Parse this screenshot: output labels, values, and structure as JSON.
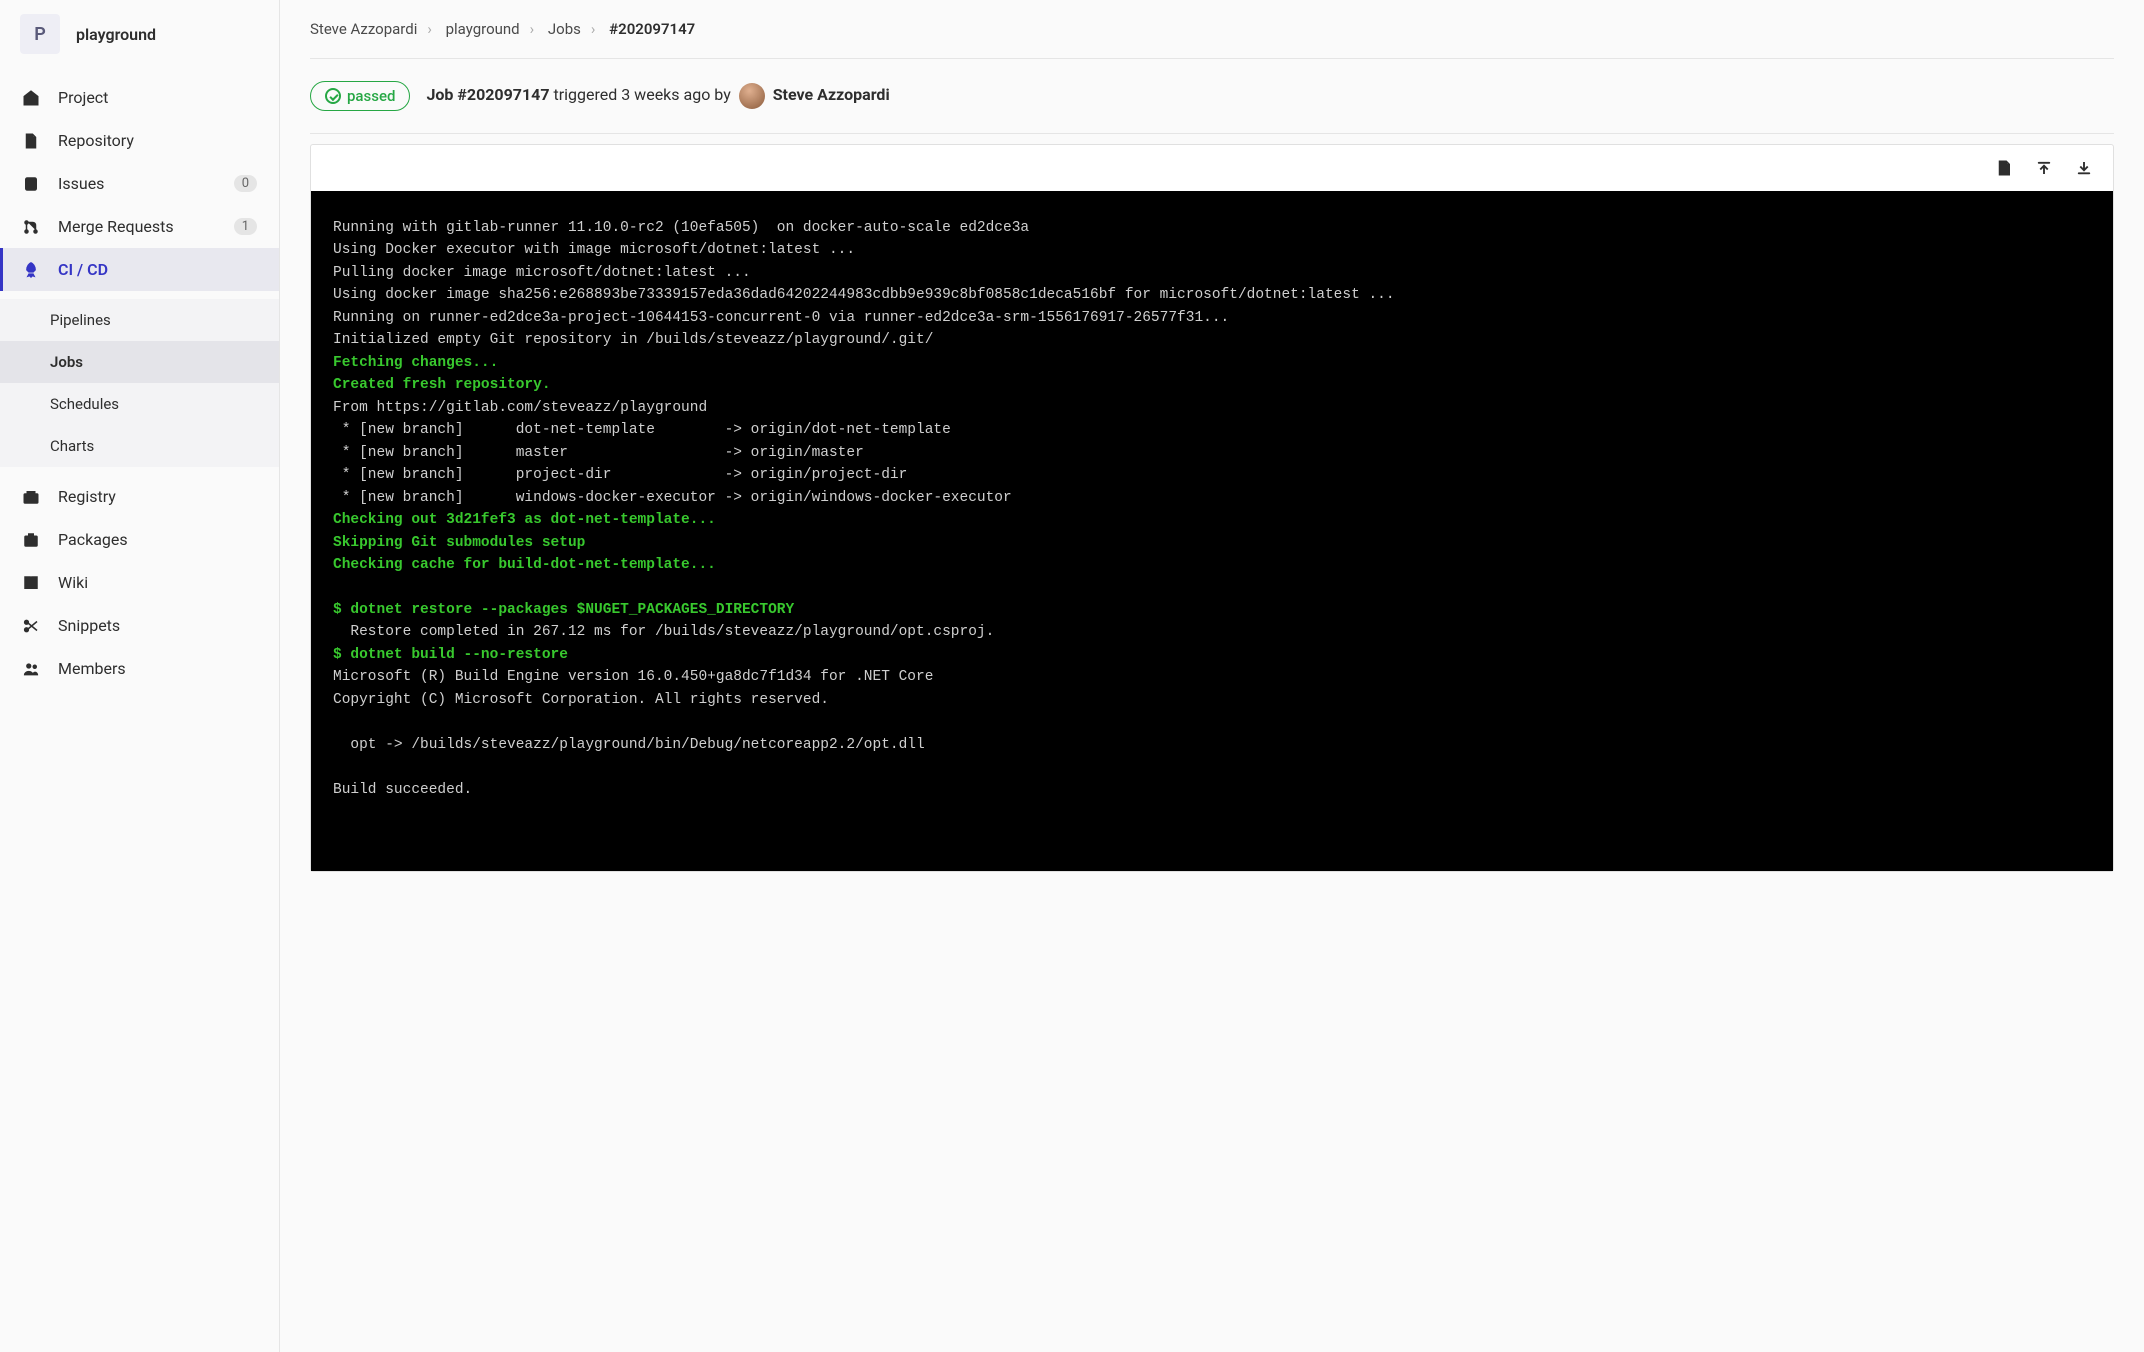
{
  "project": {
    "avatar_letter": "P",
    "name": "playground"
  },
  "sidebar": {
    "items": [
      {
        "label": "Project"
      },
      {
        "label": "Repository"
      },
      {
        "label": "Issues",
        "count": "0"
      },
      {
        "label": "Merge Requests",
        "count": "1"
      },
      {
        "label": "CI / CD"
      },
      {
        "label": "Registry"
      },
      {
        "label": "Packages"
      },
      {
        "label": "Wiki"
      },
      {
        "label": "Snippets"
      },
      {
        "label": "Members"
      }
    ],
    "subnav": [
      {
        "label": "Pipelines"
      },
      {
        "label": "Jobs"
      },
      {
        "label": "Schedules"
      },
      {
        "label": "Charts"
      }
    ]
  },
  "breadcrumbs": {
    "c0": "Steve Azzopardi",
    "c1": "playground",
    "c2": "Jobs",
    "c3": "#202097147"
  },
  "job": {
    "status": "passed",
    "title_prefix": "Job ",
    "title_id": "#202097147",
    "triggered_text": " triggered 3 weeks ago by ",
    "user": "Steve Azzopardi"
  },
  "log": {
    "l0": "Running with gitlab-runner 11.10.0-rc2 (10efa505)  on docker-auto-scale ed2dce3a",
    "l1": "Using Docker executor with image microsoft/dotnet:latest ...",
    "l2": "Pulling docker image microsoft/dotnet:latest ...",
    "l3": "Using docker image sha256:e268893be73339157eda36dad64202244983cdbb9e939c8bf0858c1deca516bf for microsoft/dotnet:latest ...",
    "l4": "Running on runner-ed2dce3a-project-10644153-concurrent-0 via runner-ed2dce3a-srm-1556176917-26577f31...",
    "l5": "Initialized empty Git repository in /builds/steveazz/playground/.git/",
    "l6": "Fetching changes...",
    "l7": "Created fresh repository.",
    "l8": "From https://gitlab.com/steveazz/playground",
    "l9": " * [new branch]      dot-net-template        -> origin/dot-net-template",
    "l10": " * [new branch]      master                  -> origin/master",
    "l11": " * [new branch]      project-dir             -> origin/project-dir",
    "l12": " * [new branch]      windows-docker-executor -> origin/windows-docker-executor",
    "l13": "Checking out 3d21fef3 as dot-net-template...",
    "l14": "Skipping Git submodules setup",
    "l15": "Checking cache for build-dot-net-template...",
    "l16": "$ dotnet restore --packages $NUGET_PACKAGES_DIRECTORY",
    "l17": "  Restore completed in 267.12 ms for /builds/steveazz/playground/opt.csproj.",
    "l18": "$ dotnet build --no-restore",
    "l19": "Microsoft (R) Build Engine version 16.0.450+ga8dc7f1d34 for .NET Core",
    "l20": "Copyright (C) Microsoft Corporation. All rights reserved.",
    "l21": "  opt -> /builds/steveazz/playground/bin/Debug/netcoreapp2.2/opt.dll",
    "l22": "Build succeeded."
  }
}
